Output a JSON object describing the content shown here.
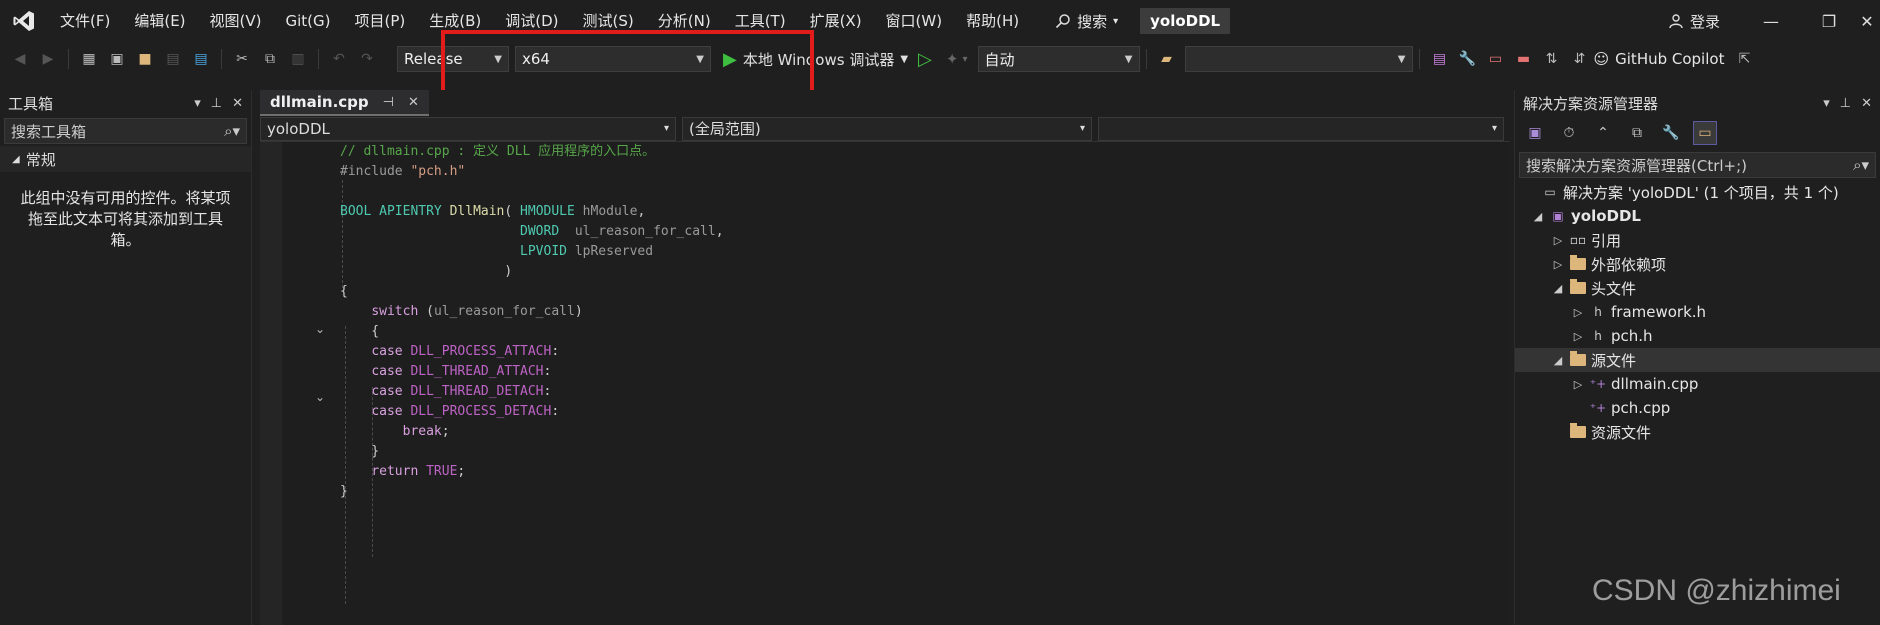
{
  "menubar": {
    "items": [
      "文件(F)",
      "编辑(E)",
      "视图(V)",
      "Git(G)",
      "项目(P)",
      "生成(B)",
      "调试(D)",
      "测试(S)",
      "分析(N)",
      "工具(T)",
      "扩展(X)",
      "窗口(W)",
      "帮助(H)"
    ],
    "search_label": "搜索",
    "solution_name": "yoloDDL",
    "login_label": "登录"
  },
  "toolbar": {
    "configuration": "Release",
    "platform": "x64",
    "debugger_label": "本地 Windows 调试器",
    "auto_label": "自动",
    "copilot_label": "GitHub Copilot",
    "highlight_color": "#e21b1b"
  },
  "toolbox": {
    "title": "工具箱",
    "search_placeholder": "搜索工具箱",
    "group": "常规",
    "message": "此组中没有可用的控件。将某项拖至此文本可将其添加到工具箱。"
  },
  "editor": {
    "tab_name": "dllmain.cpp",
    "project_combo": "yoloDDL",
    "scope_combo": "(全局范围)"
  },
  "solution_explorer": {
    "title": "解决方案资源管理器",
    "search_placeholder": "搜索解决方案资源管理器(Ctrl+;)",
    "solution_label": "解决方案 'yoloDDL' (1 个项目，共 1 个)",
    "project": "yoloDDL",
    "items": {
      "references": "引用",
      "external_deps": "外部依赖项",
      "headers": "头文件",
      "framework_h": "framework.h",
      "pch_h": "pch.h",
      "sources": "源文件",
      "dllmain_cpp": "dllmain.cpp",
      "pch_cpp": "pch.cpp",
      "resources": "资源文件"
    }
  },
  "watermark": "CSDN @zhizhimei"
}
